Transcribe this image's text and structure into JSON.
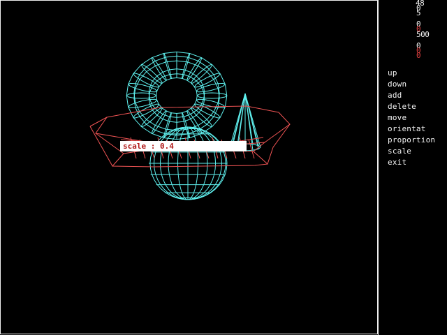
{
  "colors": {
    "background": "#000000",
    "cyan_wire": "#5ff0ee",
    "red_wire": "#f05454",
    "menu_text": "#f2f2f2",
    "status_red": "#e04040",
    "dialog_text": "#b01818",
    "dialog_bg": "#ffffff"
  },
  "status": {
    "items": [
      {
        "text": "48",
        "color": "#f2f2f2"
      },
      {
        "text": "0",
        "color": "#f2f2f2"
      },
      {
        "text": "5",
        "color": "#f2f2f2"
      },
      {
        "text": "0",
        "color": "#f2f2f2"
      },
      {
        "text": "0",
        "color": "#e04040"
      },
      {
        "text": "500",
        "color": "#f2f2f2"
      },
      {
        "text": "0",
        "color": "#f2f2f2"
      },
      {
        "text": "0",
        "color": "#e04040"
      },
      {
        "text": "0",
        "color": "#e04040"
      }
    ]
  },
  "menu": {
    "items": [
      {
        "label": "up"
      },
      {
        "label": "down"
      },
      {
        "label": "add"
      },
      {
        "label": "delete"
      },
      {
        "label": "move"
      },
      {
        "label": "orientat"
      },
      {
        "label": "proportion"
      },
      {
        "label": "scale"
      },
      {
        "label": "exit"
      }
    ]
  },
  "scale_prompt": {
    "text": "scale : 0.4"
  },
  "scene": {
    "objects": [
      "torus",
      "sphere",
      "cone",
      "flat-octagonal-disc"
    ]
  }
}
